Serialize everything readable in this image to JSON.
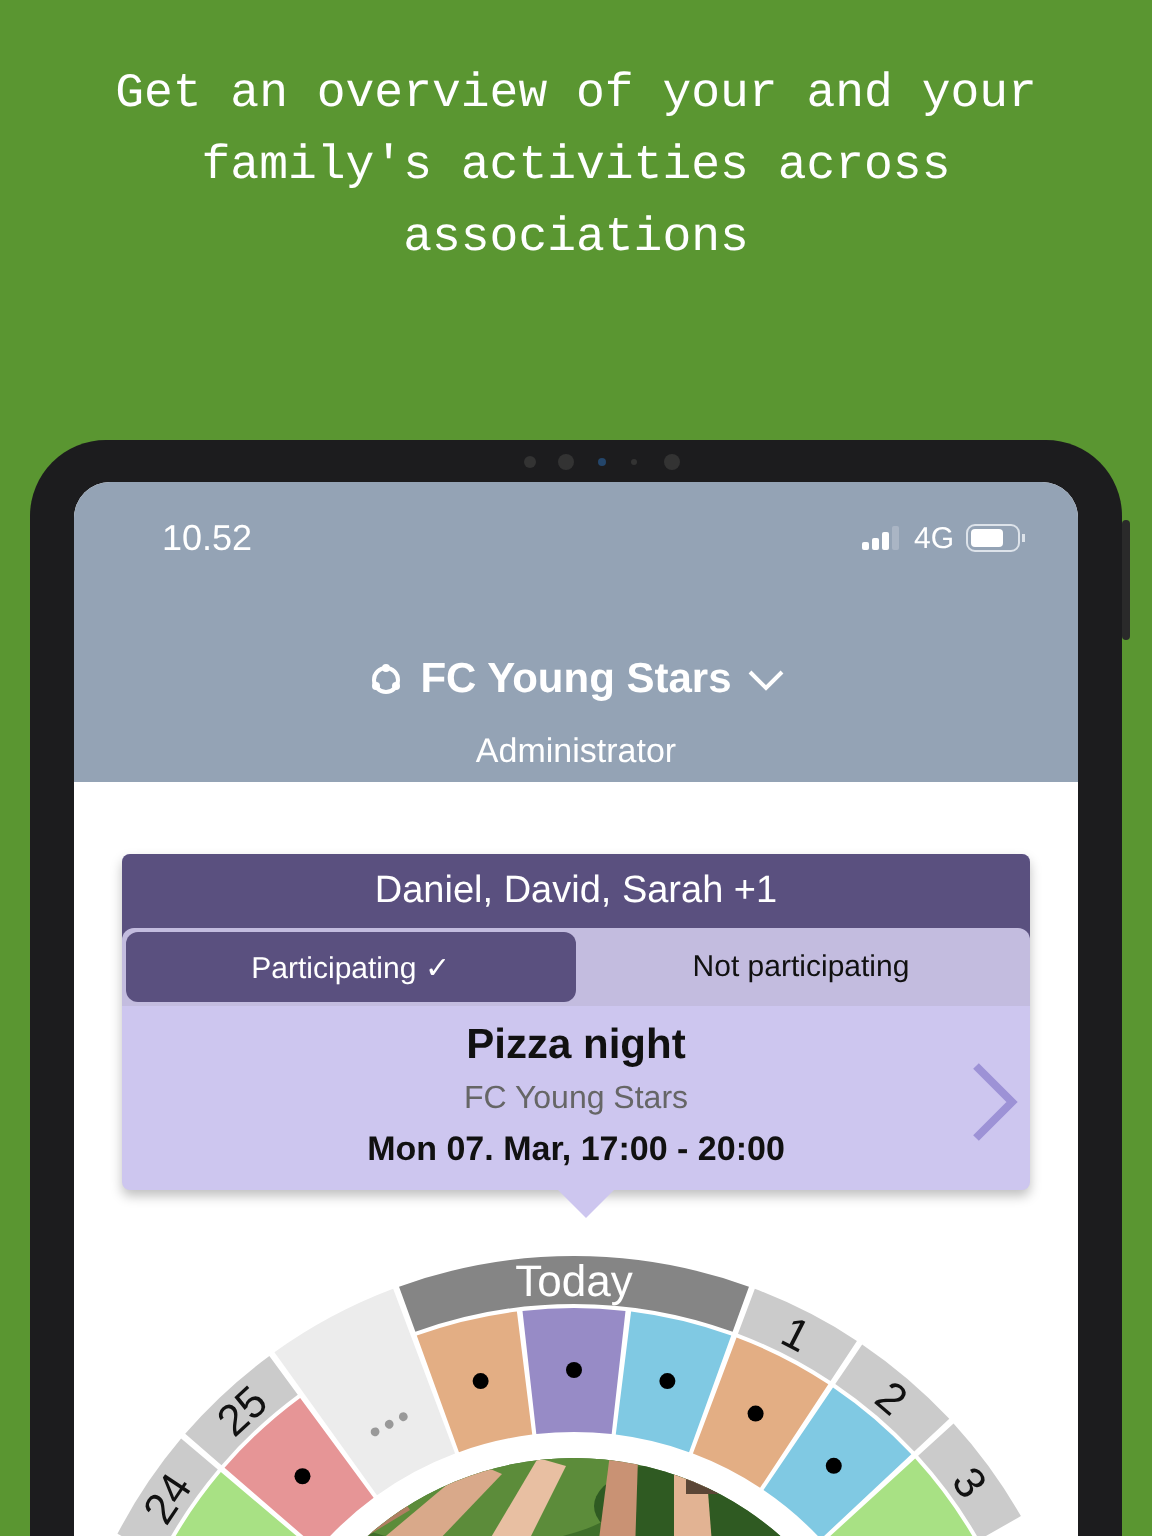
{
  "headline": "Get an overview of your and your family's activities across associations",
  "status_bar": {
    "time": "10.52",
    "network": "4G"
  },
  "header": {
    "association": "FC Young Stars",
    "role": "Administrator"
  },
  "event_card": {
    "participants": "Daniel, David, Sarah +1",
    "options": [
      {
        "label": "Participating ✓",
        "selected": true
      },
      {
        "label": "Not participating",
        "selected": false
      }
    ],
    "title": "Pizza night",
    "organizer": "FC Young Stars",
    "time": "Mon 07. Mar, 17:00 - 20:00"
  },
  "wheel": {
    "days": [
      {
        "kind": "day",
        "label": "24",
        "current": false,
        "slots": [
          {
            "color": "#a8e184"
          }
        ]
      },
      {
        "kind": "day",
        "label": "25",
        "current": false,
        "slots": [
          {
            "color": "#e69596",
            "dot": true
          }
        ]
      },
      {
        "kind": "more"
      },
      {
        "kind": "day",
        "label": "Today",
        "current": true,
        "slots": [
          {
            "color": "#e3ae84",
            "dot": true
          },
          {
            "color": "#978bc6",
            "dot": true
          },
          {
            "color": "#80c9e3",
            "dot": true
          }
        ]
      },
      {
        "kind": "day",
        "label": "1",
        "current": false,
        "slots": [
          {
            "color": "#e3ae84",
            "dot": true
          }
        ]
      },
      {
        "kind": "day",
        "label": "2",
        "current": false,
        "slots": [
          {
            "color": "#80c9e3",
            "dot": true
          }
        ]
      },
      {
        "kind": "day",
        "label": "3",
        "current": false,
        "slots": [
          {
            "color": "#a8e184"
          }
        ]
      }
    ]
  }
}
